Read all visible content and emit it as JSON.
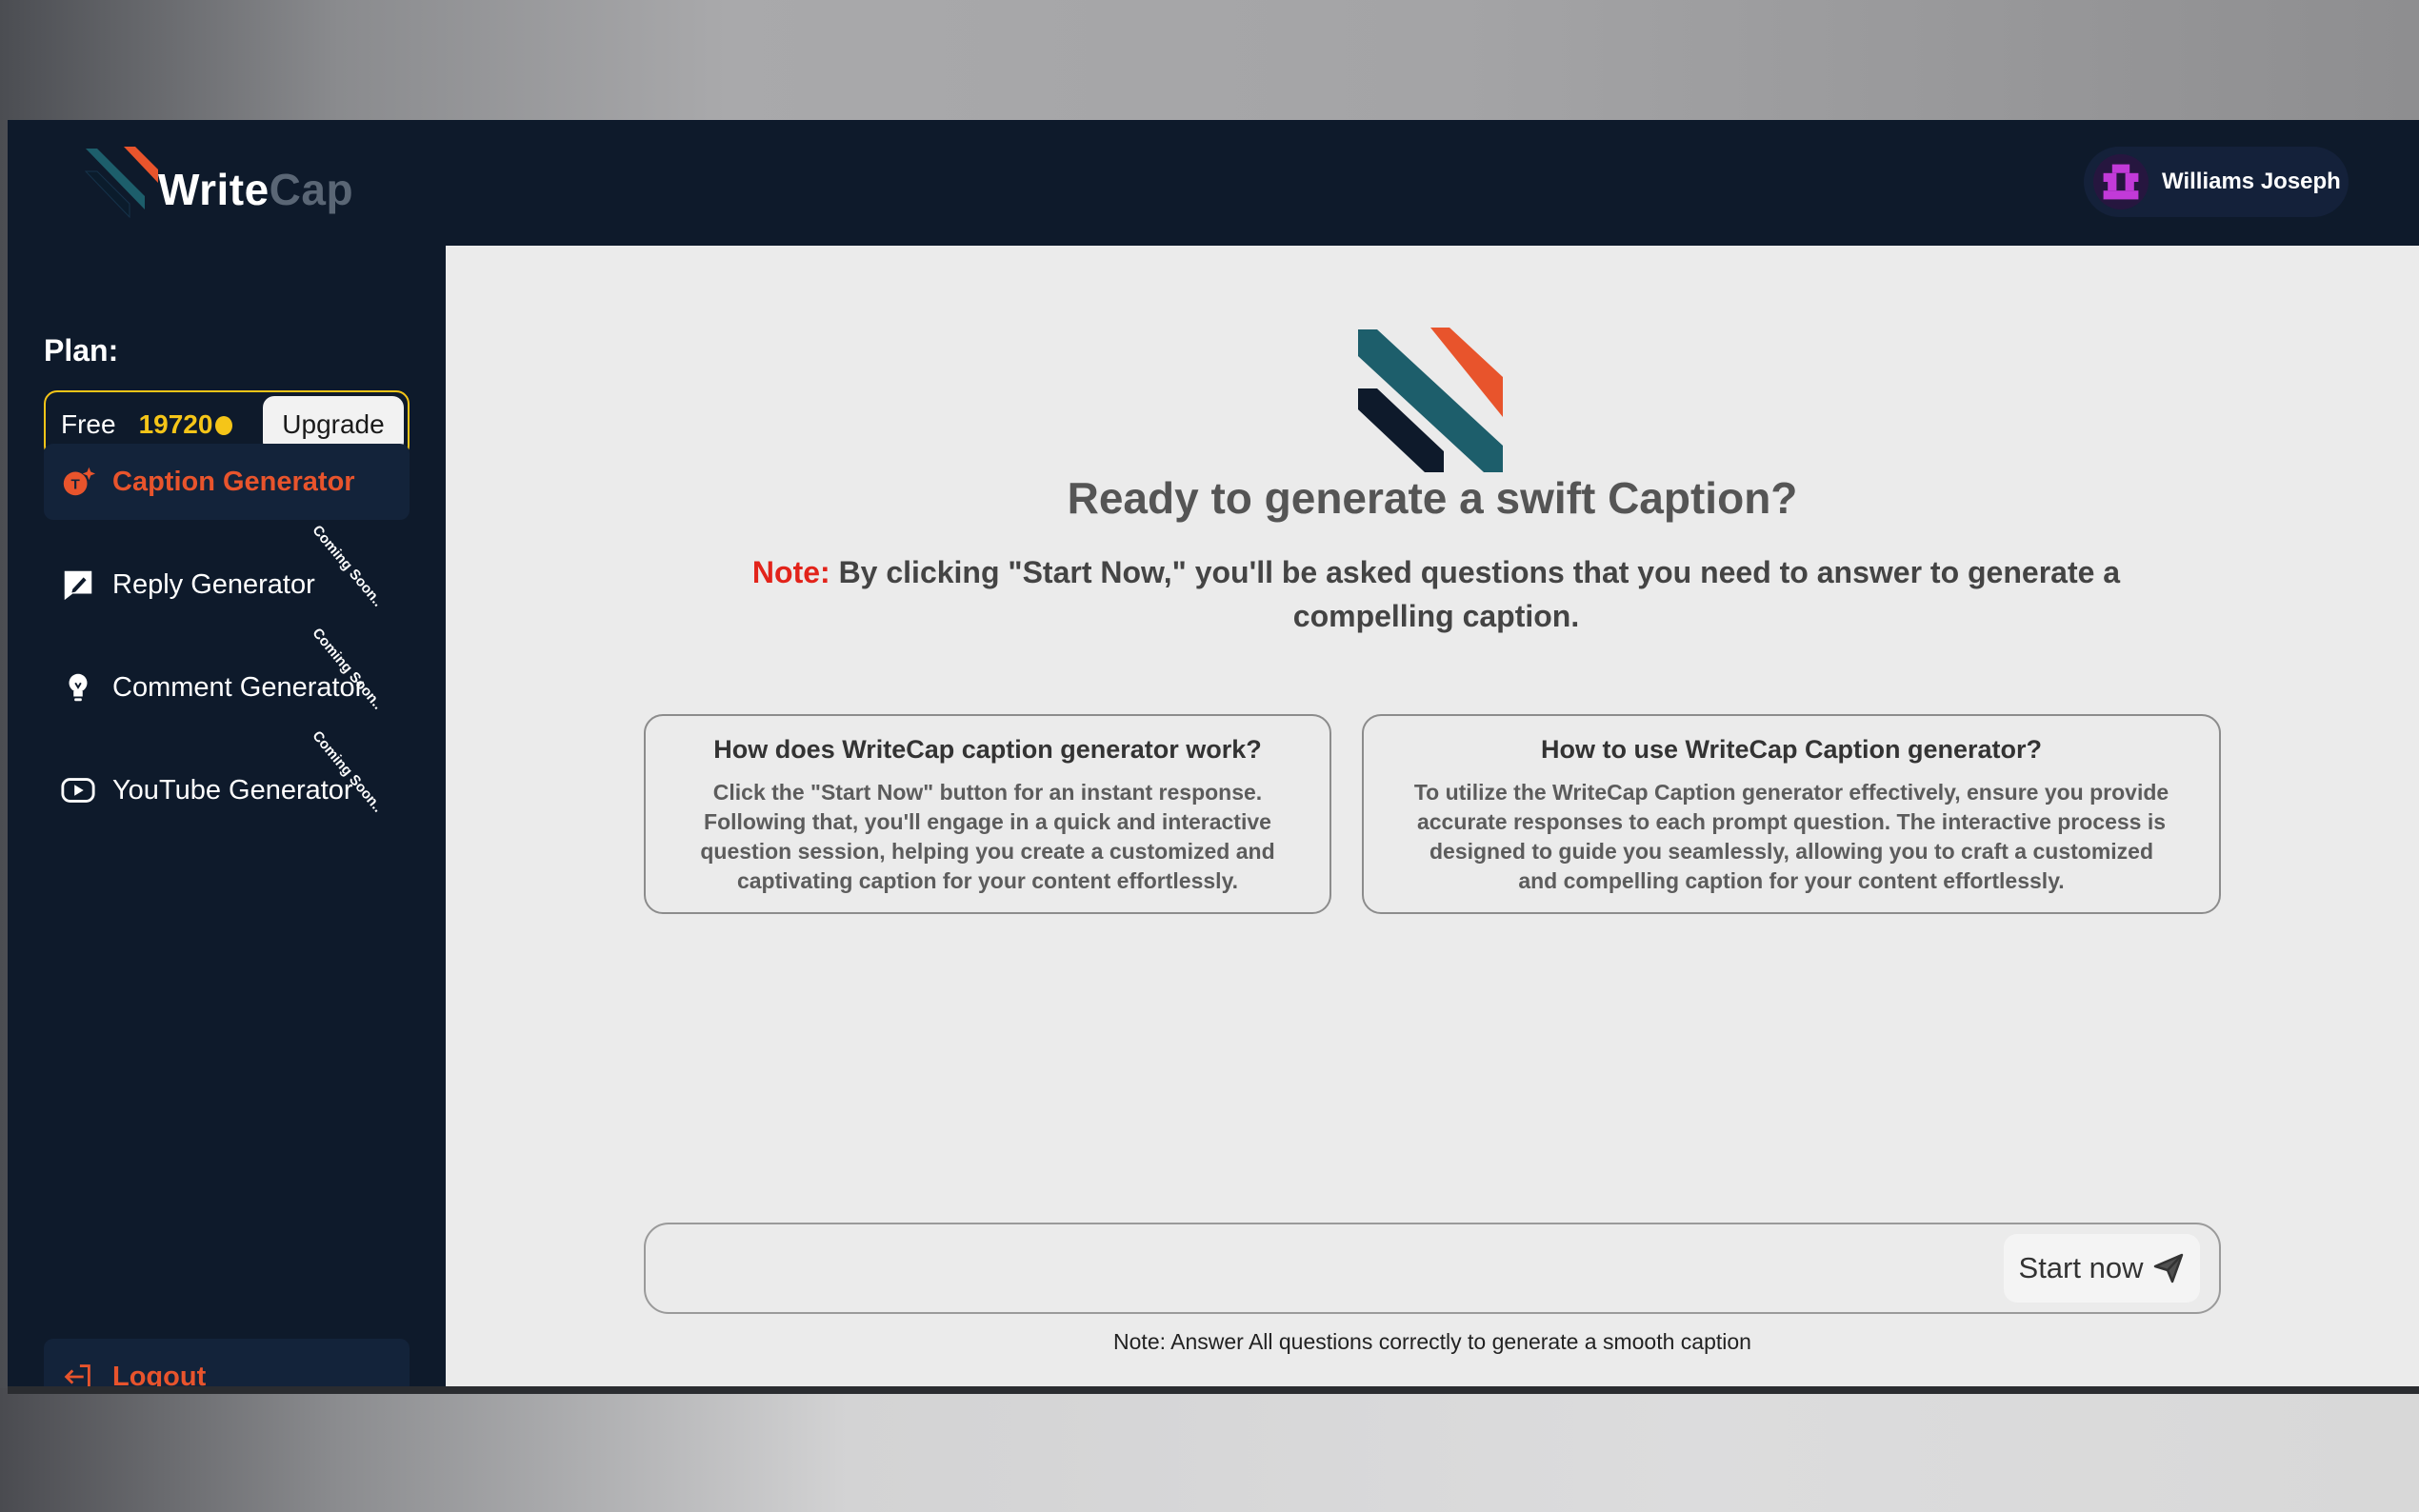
{
  "brand": {
    "name_part1": "Write",
    "name_part2": "Cap"
  },
  "user": {
    "name": "Williams Joseph"
  },
  "plan": {
    "label": "Plan:",
    "name": "Free",
    "credits": "19720",
    "upgrade_label": "Upgrade"
  },
  "sidebar": {
    "items": [
      {
        "label": "Caption Generator",
        "icon": "caption-ai-icon",
        "active": true,
        "badge": ""
      },
      {
        "label": "Reply Generator",
        "icon": "reply-edit-icon",
        "active": false,
        "badge": "Coming Soon.."
      },
      {
        "label": "Comment Generator",
        "icon": "lightbulb-icon",
        "active": false,
        "badge": "Coming Soon.."
      },
      {
        "label": "YouTube Generator",
        "icon": "youtube-icon",
        "active": false,
        "badge": "Coming Soon.."
      }
    ],
    "logout_label": "Logout"
  },
  "main": {
    "title": "Ready to generate a swift Caption?",
    "note_label": "Note:",
    "note_text": " By clicking \"Start Now,\" you'll be asked questions that you need to answer to generate a compelling caption.",
    "cards": [
      {
        "title": "How does WriteCap caption generator work?",
        "body": "Click the \"Start Now\" button for an instant response. Following that, you'll engage in a quick and interactive question session, helping you create a customized and captivating caption for your content effortlessly."
      },
      {
        "title": "How to use WriteCap Caption generator?",
        "body": "To utilize the WriteCap Caption generator effectively, ensure you provide accurate responses to each prompt question. The interactive process is designed to guide you seamlessly, allowing you to craft a customized and compelling caption for your content effortlessly."
      }
    ],
    "input": {
      "value": "",
      "placeholder": ""
    },
    "start_label": "Start now",
    "bottom_note": "Note: Answer All questions correctly to generate a smooth caption"
  },
  "colors": {
    "sidebar_bg": "#0e1a2b",
    "accent_orange": "#e8542c",
    "accent_teal": "#1d5e6b",
    "credits_gold": "#f5c518",
    "note_red": "#e2231a"
  }
}
